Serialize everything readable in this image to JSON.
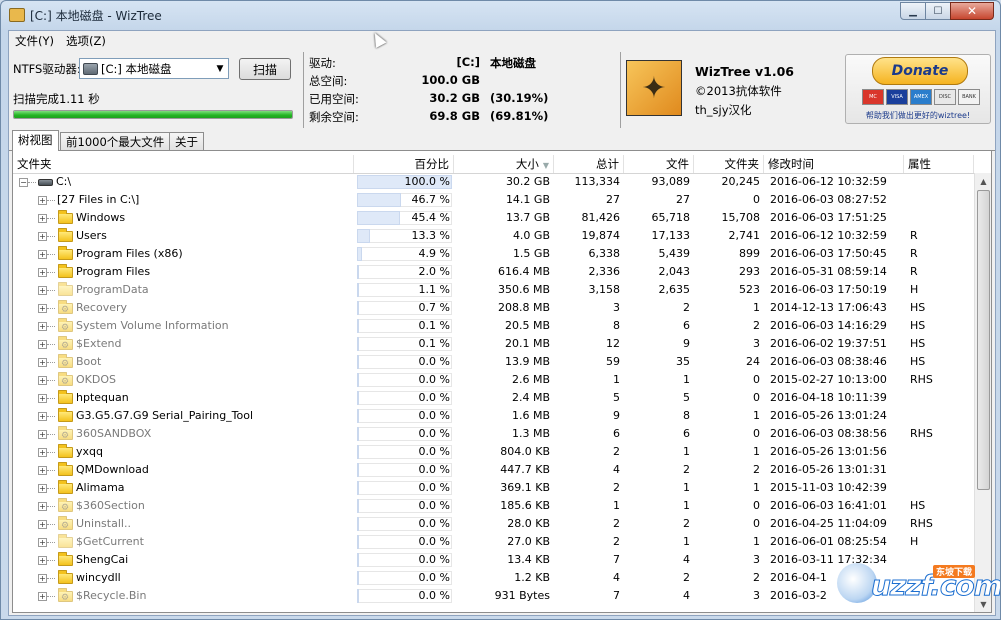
{
  "window": {
    "title": "[C:] 本地磁盘  - WizTree"
  },
  "menu": [
    "文件(Y)",
    "选项(Z)"
  ],
  "header": {
    "drive_label": "NTFS驱动器:",
    "drive_select": "[C:] 本地磁盘",
    "scan_button": "扫描",
    "status": "扫描完成1.11 秒",
    "progress": 1.0,
    "info": {
      "drive_k": "驱动:",
      "drive_v": "[C:]",
      "drive_name": "本地磁盘",
      "total_k": "总空间:",
      "total_v": "100.0 GB",
      "used_k": "已用空间:",
      "used_v": "30.2 GB",
      "used_pct": "(30.19%)",
      "free_k": "剩余空间:",
      "free_v": "69.8 GB",
      "free_pct": "(69.81%)"
    },
    "about": {
      "name": "WizTree v1.06",
      "copyright": "©2013抗体软件",
      "translator": "th_sjy汉化"
    },
    "donate": {
      "button": "Donate",
      "note": "帮助我们做出更好的wiztree!",
      "cards": [
        "MC",
        "VISA",
        "AMEX",
        "DISC",
        "BANK"
      ]
    }
  },
  "tabs": [
    "树视图",
    "前1000个最大文件",
    "关于"
  ],
  "columns": [
    "文件夹",
    "百分比",
    "大小",
    "总计",
    "文件",
    "文件夹",
    "修改时间",
    "属性"
  ],
  "rows": [
    {
      "name": "C:\\",
      "pct": "100.0 %",
      "pv": 100.0,
      "size": "30.2 GB",
      "total": "113,334",
      "files": "93,089",
      "folders": "20,245",
      "mod": "2016-06-12 10:32:59",
      "attr": "",
      "type": "drive",
      "root": true
    },
    {
      "name": "[27 Files in C:\\]",
      "pct": "46.7 %",
      "pv": 46.7,
      "size": "14.1 GB",
      "total": "27",
      "files": "27",
      "folders": "0",
      "mod": "2016-06-03 08:27:52",
      "attr": "",
      "type": "none"
    },
    {
      "name": "Windows",
      "pct": "45.4 %",
      "pv": 45.4,
      "size": "13.7 GB",
      "total": "81,426",
      "files": "65,718",
      "folders": "15,708",
      "mod": "2016-06-03 17:51:25",
      "attr": "",
      "type": "folder"
    },
    {
      "name": "Users",
      "pct": "13.3 %",
      "pv": 13.3,
      "size": "4.0 GB",
      "total": "19,874",
      "files": "17,133",
      "folders": "2,741",
      "mod": "2016-06-12 10:32:59",
      "attr": "R",
      "type": "folder"
    },
    {
      "name": "Program Files (x86)",
      "pct": "4.9 %",
      "pv": 4.9,
      "size": "1.5 GB",
      "total": "6,338",
      "files": "5,439",
      "folders": "899",
      "mod": "2016-06-03 17:50:45",
      "attr": "R",
      "type": "folder"
    },
    {
      "name": "Program Files",
      "pct": "2.0 %",
      "pv": 2.0,
      "size": "616.4 MB",
      "total": "2,336",
      "files": "2,043",
      "folders": "293",
      "mod": "2016-05-31 08:59:14",
      "attr": "R",
      "type": "folder"
    },
    {
      "name": "ProgramData",
      "pct": "1.1 %",
      "pv": 1.1,
      "size": "350.6 MB",
      "total": "3,158",
      "files": "2,635",
      "folders": "523",
      "mod": "2016-06-03 17:50:19",
      "attr": "H",
      "type": "hidden"
    },
    {
      "name": "Recovery",
      "pct": "0.7 %",
      "pv": 0.7,
      "size": "208.8 MB",
      "total": "3",
      "files": "2",
      "folders": "1",
      "mod": "2014-12-13 17:06:43",
      "attr": "HS",
      "type": "sys"
    },
    {
      "name": "System Volume Information",
      "pct": "0.1 %",
      "pv": 0.1,
      "size": "20.5 MB",
      "total": "8",
      "files": "6",
      "folders": "2",
      "mod": "2016-06-03 14:16:29",
      "attr": "HS",
      "type": "sys"
    },
    {
      "name": "$Extend",
      "pct": "0.1 %",
      "pv": 0.1,
      "size": "20.1 MB",
      "total": "12",
      "files": "9",
      "folders": "3",
      "mod": "2016-06-02 19:37:51",
      "attr": "HS",
      "type": "sys"
    },
    {
      "name": "Boot",
      "pct": "0.0 %",
      "pv": 0.0,
      "size": "13.9 MB",
      "total": "59",
      "files": "35",
      "folders": "24",
      "mod": "2016-06-03 08:38:46",
      "attr": "HS",
      "type": "sys"
    },
    {
      "name": "OKDOS",
      "pct": "0.0 %",
      "pv": 0.0,
      "size": "2.6 MB",
      "total": "1",
      "files": "1",
      "folders": "0",
      "mod": "2015-02-27 10:13:00",
      "attr": "RHS",
      "type": "sys"
    },
    {
      "name": "hptequan",
      "pct": "0.0 %",
      "pv": 0.0,
      "size": "2.4 MB",
      "total": "5",
      "files": "5",
      "folders": "0",
      "mod": "2016-04-18 10:11:39",
      "attr": "",
      "type": "folder"
    },
    {
      "name": "G3.G5.G7.G9 Serial_Pairing_Tool",
      "pct": "0.0 %",
      "pv": 0.0,
      "size": "1.6 MB",
      "total": "9",
      "files": "8",
      "folders": "1",
      "mod": "2016-05-26 13:01:24",
      "attr": "",
      "type": "folder"
    },
    {
      "name": "360SANDBOX",
      "pct": "0.0 %",
      "pv": 0.0,
      "size": "1.3 MB",
      "total": "6",
      "files": "6",
      "folders": "0",
      "mod": "2016-06-03 08:38:56",
      "attr": "RHS",
      "type": "sys"
    },
    {
      "name": "yxqq",
      "pct": "0.0 %",
      "pv": 0.0,
      "size": "804.0 KB",
      "total": "2",
      "files": "1",
      "folders": "1",
      "mod": "2016-05-26 13:01:56",
      "attr": "",
      "type": "folder"
    },
    {
      "name": "QMDownload",
      "pct": "0.0 %",
      "pv": 0.0,
      "size": "447.7 KB",
      "total": "4",
      "files": "2",
      "folders": "2",
      "mod": "2016-05-26 13:01:31",
      "attr": "",
      "type": "folder"
    },
    {
      "name": "Alimama",
      "pct": "0.0 %",
      "pv": 0.0,
      "size": "369.1 KB",
      "total": "2",
      "files": "1",
      "folders": "1",
      "mod": "2015-11-03 10:42:39",
      "attr": "",
      "type": "folder"
    },
    {
      "name": "$360Section",
      "pct": "0.0 %",
      "pv": 0.0,
      "size": "185.6 KB",
      "total": "1",
      "files": "1",
      "folders": "0",
      "mod": "2016-06-03 16:41:01",
      "attr": "HS",
      "type": "sys"
    },
    {
      "name": "Uninstall..",
      "pct": "0.0 %",
      "pv": 0.0,
      "size": "28.0 KB",
      "total": "2",
      "files": "2",
      "folders": "0",
      "mod": "2016-04-25 11:04:09",
      "attr": "RHS",
      "type": "sys"
    },
    {
      "name": "$GetCurrent",
      "pct": "0.0 %",
      "pv": 0.0,
      "size": "27.0 KB",
      "total": "2",
      "files": "1",
      "folders": "1",
      "mod": "2016-06-01 08:25:54",
      "attr": "H",
      "type": "hidden"
    },
    {
      "name": "ShengCai",
      "pct": "0.0 %",
      "pv": 0.0,
      "size": "13.4 KB",
      "total": "7",
      "files": "4",
      "folders": "3",
      "mod": "2016-03-11 17:32:34",
      "attr": "",
      "type": "folder"
    },
    {
      "name": "wincydll",
      "pct": "0.0 %",
      "pv": 0.0,
      "size": "1.2 KB",
      "total": "4",
      "files": "2",
      "folders": "2",
      "mod": "2016-04-1",
      "attr": "",
      "type": "folder"
    },
    {
      "name": "$Recycle.Bin",
      "pct": "0.0 %",
      "pv": 0.0,
      "size": "931 Bytes",
      "total": "7",
      "files": "4",
      "folders": "3",
      "mod": "2016-03-2",
      "attr": "",
      "type": "sys"
    }
  ],
  "watermark": {
    "text": "uzzf.com",
    "badge": "东坡下载"
  }
}
